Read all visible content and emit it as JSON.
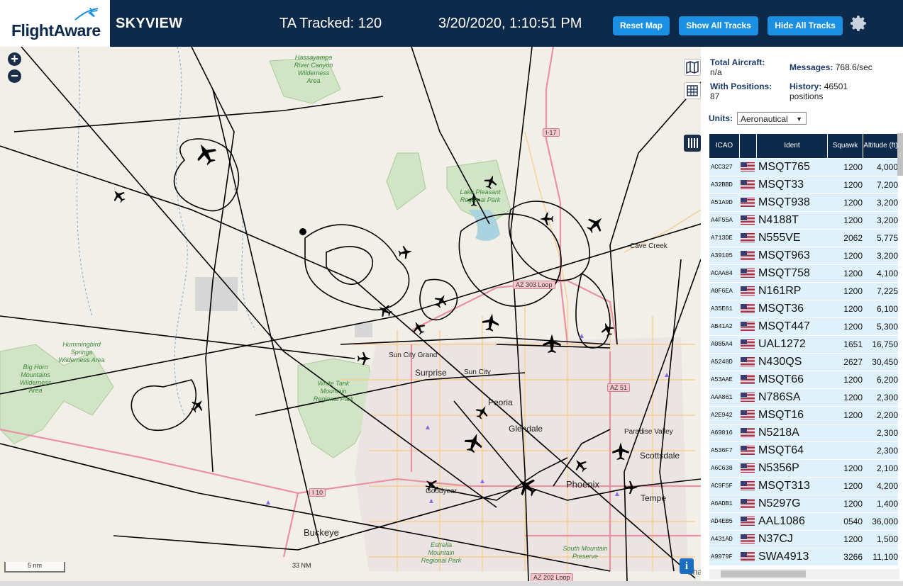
{
  "header": {
    "logo_text": "FlightAware",
    "app_name": "SKYVIEW",
    "tracked_label": "TA Tracked: 120",
    "datetime": "3/20/2020, 1:10:51 PM",
    "buttons": {
      "reset": "Reset Map",
      "show_all": "Show All Tracks",
      "hide_all": "Hide All Tracks"
    }
  },
  "map": {
    "zoom_in": "+",
    "zoom_out": "−",
    "scale_km": "5 nm",
    "scale_nm": "33 NM",
    "info": "i",
    "labels": {
      "surprise": "Surprise",
      "sun_city": "Sun City",
      "sun_city_grand": "Sun City Grand",
      "peoria": "Peoria",
      "glendale": "Glendale",
      "phoenix": "Phoenix",
      "scottsdale": "Scottsdale",
      "paradise_valley": "Paradise Valley",
      "tempe": "Tempe",
      "buckeye": "Buckeye",
      "goodyear": "Goodyear",
      "cave_creek": "Cave Creek",
      "cha": "Cha"
    },
    "parks": {
      "hassayampa": "Hassayampa River Canyon Wilderness Area",
      "lake_pleasant": "Lake Pleasant Regional Park",
      "hummingbird": "Hummingbird Springs Wilderness Area",
      "big_horn": "Big Horn Mountains Wilderness Area",
      "white_tank": "White Tank Mountain Regional Park",
      "estrella": "Estrella Mountain Regional Park",
      "south_mountain": "South Mountain Preserve"
    },
    "shields": {
      "i17": "I-17",
      "az303": "AZ 303 Loop",
      "az51": "AZ 51",
      "i10": "I 10",
      "az202": "AZ 202 Loop"
    }
  },
  "stats": {
    "total_aircraft_label": "Total Aircraft:",
    "total_aircraft_value": "n/a",
    "with_positions_label": "With Positions:",
    "with_positions_value": "87",
    "messages_label": "Messages:",
    "messages_value": "768.6/sec",
    "history_label": "History:",
    "history_value": "46501",
    "history_unit": "positions"
  },
  "units": {
    "label": "Units:",
    "selected": "Aeronautical"
  },
  "table": {
    "headers": {
      "icao": "ICAO",
      "flag": "",
      "ident": "Ident",
      "squawk": "Squawk",
      "altitude": "Altitude (ft)"
    },
    "rows": [
      {
        "icao": "ACC327",
        "ident": "MSQT765",
        "squawk": "1200",
        "alt": "4,000"
      },
      {
        "icao": "A32BBD",
        "ident": "MSQT33",
        "squawk": "1200",
        "alt": "7,200"
      },
      {
        "icao": "A51A9D",
        "ident": "MSQT938",
        "squawk": "1200",
        "alt": "3,200"
      },
      {
        "icao": "A4F55A",
        "ident": "N4188T",
        "squawk": "1200",
        "alt": "3,200"
      },
      {
        "icao": "A713DE",
        "ident": "N555VE",
        "squawk": "2062",
        "alt": "5,775"
      },
      {
        "icao": "A39105",
        "ident": "MSQT963",
        "squawk": "1200",
        "alt": "3,200"
      },
      {
        "icao": "ACAA84",
        "ident": "MSQT758",
        "squawk": "1200",
        "alt": "4,100"
      },
      {
        "icao": "A0F6EA",
        "ident": "N161RP",
        "squawk": "1200",
        "alt": "7,225"
      },
      {
        "icao": "A35E61",
        "ident": "MSQT36",
        "squawk": "1200",
        "alt": "6,100"
      },
      {
        "icao": "AB41A2",
        "ident": "MSQT447",
        "squawk": "1200",
        "alt": "5,300"
      },
      {
        "icao": "A085A4",
        "ident": "UAL1272",
        "squawk": "1651",
        "alt": "16,750"
      },
      {
        "icao": "A5248D",
        "ident": "N430QS",
        "squawk": "2627",
        "alt": "30,450"
      },
      {
        "icao": "A53AAE",
        "ident": "MSQT66",
        "squawk": "1200",
        "alt": "6,200"
      },
      {
        "icao": "AAA861",
        "ident": "N786SA",
        "squawk": "1200",
        "alt": "2,300"
      },
      {
        "icao": "A2E942",
        "ident": "MSQT16",
        "squawk": "1200",
        "alt": "2,200"
      },
      {
        "icao": "A69016",
        "ident": "N5218A",
        "squawk": "",
        "alt": "2,300"
      },
      {
        "icao": "A536F7",
        "ident": "MSQT64",
        "squawk": "",
        "alt": "2,300"
      },
      {
        "icao": "A6C638",
        "ident": "N5356P",
        "squawk": "1200",
        "alt": "2,100"
      },
      {
        "icao": "AC9F5F",
        "ident": "MSQT313",
        "squawk": "1200",
        "alt": "4,200"
      },
      {
        "icao": "A6ADB1",
        "ident": "N5297G",
        "squawk": "1200",
        "alt": "1,400"
      },
      {
        "icao": "AD4EB5",
        "ident": "AAL1086",
        "squawk": "0540",
        "alt": "36,000"
      },
      {
        "icao": "A431AD",
        "ident": "N37CJ",
        "squawk": "1200",
        "alt": "1,500"
      },
      {
        "icao": "A9979F",
        "ident": "SWA4913",
        "squawk": "3266",
        "alt": "11,100"
      }
    ]
  },
  "colors": {
    "header_bg": "#0e2a4a",
    "button_bg": "#1b90e3",
    "row_bg": "#dff1fb",
    "map_bg": "#f2efe9",
    "track": "#000000"
  },
  "icons": {
    "gear": "gear-icon",
    "map": "map-layers-icon",
    "grid": "grid-icon",
    "columns": "columns-icon",
    "flag": "us-flag-icon"
  }
}
